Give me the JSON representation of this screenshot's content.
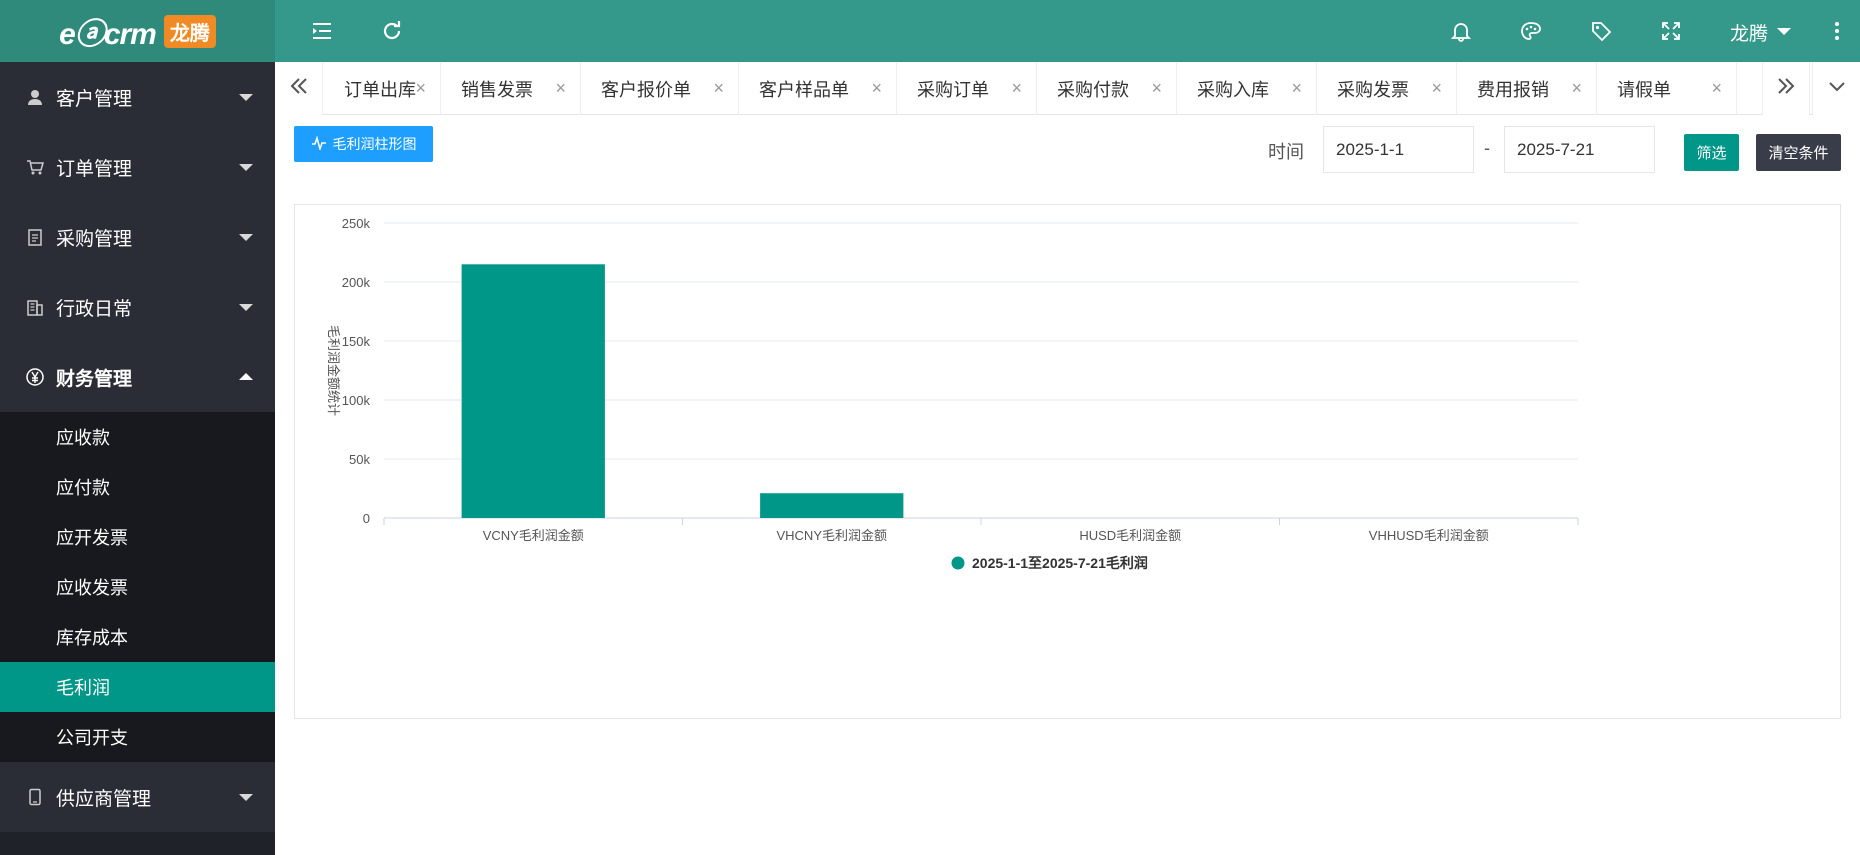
{
  "brand": {
    "logo_text": "eⓐcrm",
    "badge": "龙腾"
  },
  "sidebar": {
    "groups": [
      {
        "label": "客户管理",
        "icon": "user-icon"
      },
      {
        "label": "订单管理",
        "icon": "cart-icon"
      },
      {
        "label": "采购管理",
        "icon": "clipboard-icon"
      },
      {
        "label": "行政日常",
        "icon": "building-icon"
      },
      {
        "label": "财务管理",
        "icon": "yen-icon"
      },
      {
        "label": "供应商管理",
        "icon": "phone-icon"
      }
    ],
    "finance_items": [
      {
        "label": "应收款"
      },
      {
        "label": "应付款"
      },
      {
        "label": "应开发票"
      },
      {
        "label": "应收发票"
      },
      {
        "label": "库存成本"
      },
      {
        "label": "毛利润"
      },
      {
        "label": "公司开支"
      }
    ]
  },
  "header": {
    "user_name": "龙腾"
  },
  "tabs": [
    {
      "label": "订单出库"
    },
    {
      "label": "销售发票"
    },
    {
      "label": "客户报价单"
    },
    {
      "label": "客户样品单"
    },
    {
      "label": "采购订单"
    },
    {
      "label": "采购付款"
    },
    {
      "label": "采购入库"
    },
    {
      "label": "采购发票"
    },
    {
      "label": "费用报销"
    },
    {
      "label": "请假单"
    }
  ],
  "toolbar": {
    "chart_button": "毛利润柱形图",
    "time_label": "时间",
    "start_date": "2025-1-1",
    "separator": "-",
    "end_date": "2025-7-21",
    "filter_button": "筛选",
    "clear_button": "清空条件"
  },
  "chart_data": {
    "type": "bar",
    "categories": [
      "VCNY毛利润金额",
      "VHCNY毛利润金额",
      "HUSD毛利润金额",
      "VHHUSD毛利润金额"
    ],
    "series": [
      {
        "name": "2025-1-1至2025-7-21毛利润",
        "values": [
          215000,
          21000,
          0,
          0
        ]
      }
    ],
    "ylabel": "毛利润金额统计",
    "ylim": [
      0,
      250000
    ],
    "yticks": [
      "0",
      "50k",
      "100k",
      "150k",
      "200k",
      "250k"
    ],
    "grid": true,
    "legend_position": "bottom-center",
    "color": "#009688"
  }
}
